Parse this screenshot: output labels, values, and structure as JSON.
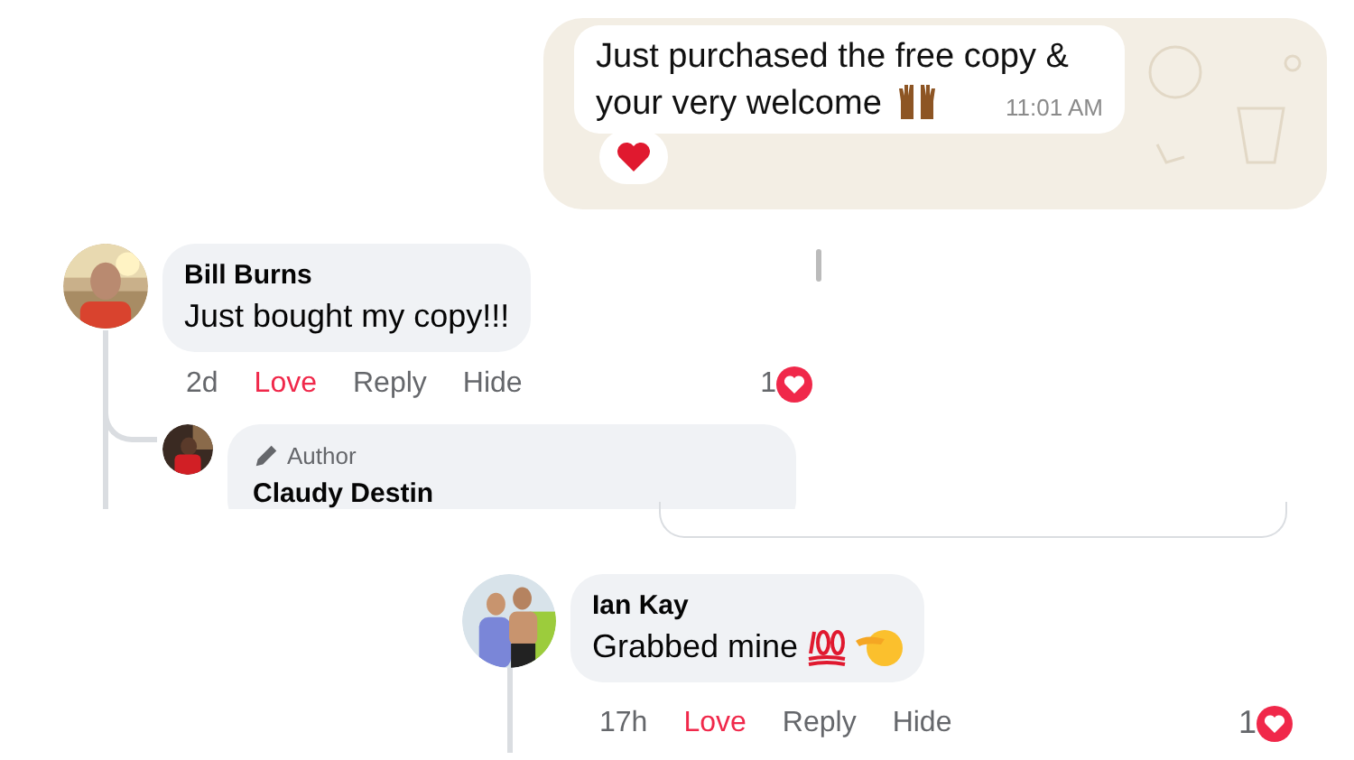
{
  "chat_message": {
    "lines": [
      "Just purchased the free copy &",
      "your very welcome"
    ],
    "time": "11:01 AM"
  },
  "comments": [
    {
      "name": "Bill Burns",
      "text": "Just bought my copy!!!",
      "time": "2d",
      "actions": [
        {
          "label": "Love",
          "selected": true
        },
        {
          "label": "Reply",
          "selected": false
        },
        {
          "label": "Hide",
          "selected": false
        }
      ],
      "reaction_count": "1",
      "reply": {
        "badge": "Author",
        "name": "Claudy Destin"
      }
    },
    {
      "name": "Ian Kay",
      "text": "Grabbed mine",
      "time": "17h",
      "actions": [
        {
          "label": "Love",
          "selected": true
        },
        {
          "label": "Reply",
          "selected": false
        },
        {
          "label": "Hide",
          "selected": false
        }
      ],
      "reaction_count": "1"
    }
  ]
}
